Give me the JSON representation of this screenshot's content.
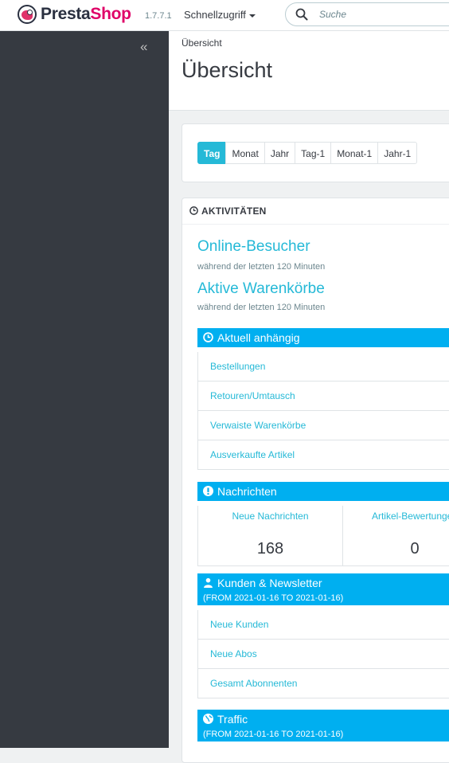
{
  "header": {
    "brand_presta": "Presta",
    "brand_shop": "Shop",
    "version": "1.7.7.1",
    "quick_access": "Schnellzugriff",
    "search_placeholder": "Suche"
  },
  "sidebar": {
    "collapse_label": "«"
  },
  "page": {
    "breadcrumb": "Übersicht",
    "title": "Übersicht"
  },
  "calendar": {
    "buttons": [
      "Tag",
      "Monat",
      "Jahr",
      "Tag-1",
      "Monat-1",
      "Jahr-1"
    ],
    "active": "Tag"
  },
  "activity": {
    "title": "AKTIVITÄTEN",
    "online_visitors": "Online-Besucher",
    "online_visitors_sub": "während der letzten 120 Minuten",
    "active_carts": "Aktive Warenkörbe",
    "active_carts_sub": "während der letzten 120 Minuten",
    "pending": {
      "title": "Aktuell anhängig",
      "items": [
        "Bestellungen",
        "Retouren/Umtausch",
        "Verwaiste Warenkörbe",
        "Ausverkaufte Artikel"
      ]
    },
    "messages": {
      "title": "Nachrichten",
      "new_messages_label": "Neue Nachrichten",
      "new_messages_value": "168",
      "reviews_label": "Artikel-Bewertungen",
      "reviews_value": "0"
    },
    "customers": {
      "title": "Kunden & Newsletter",
      "range": "(FROM 2021-01-16 TO 2021-01-16)",
      "items": [
        "Neue Kunden",
        "Neue Abos",
        "Gesamt Abonnenten"
      ]
    },
    "traffic": {
      "title": "Traffic",
      "range": "(FROM 2021-01-16 TO 2021-01-16)"
    }
  },
  "colors": {
    "accent": "#25b9d7",
    "section_bar": "#00aff0",
    "sidebar": "#363a41",
    "brand_pink": "#df0067"
  }
}
